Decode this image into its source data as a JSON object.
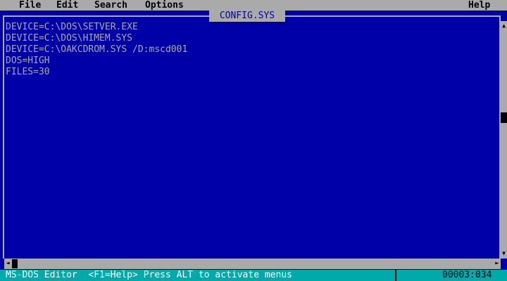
{
  "menu": {
    "items": [
      {
        "label": "File"
      },
      {
        "label": "Edit"
      },
      {
        "label": "Search"
      },
      {
        "label": "Options"
      }
    ],
    "help": "Help"
  },
  "window": {
    "title": "CONFIG.SYS"
  },
  "document": {
    "lines": [
      "DEVICE=C:\\DOS\\SETVER.EXE",
      "DEVICE=C:\\DOS\\HIMEM.SYS",
      "DEVICE=C:\\OAKCDROM.SYS /D:mscd001",
      "DOS=HIGH",
      "FILES=30"
    ]
  },
  "status": {
    "text": "MS-DOS Editor  <F1=Help> Press ALT to activate menus",
    "position": "00003:034"
  },
  "icons": {
    "scroll_up": "arrow-up-icon",
    "scroll_down": "arrow-down-icon",
    "scroll_left": "arrow-left-icon",
    "scroll_right": "arrow-right-icon"
  },
  "colors": {
    "editor_bg": "#0000a8",
    "text": "#aaaaaa",
    "menu_bg": "#aaaaaa",
    "status_bg": "#00aaaa"
  }
}
